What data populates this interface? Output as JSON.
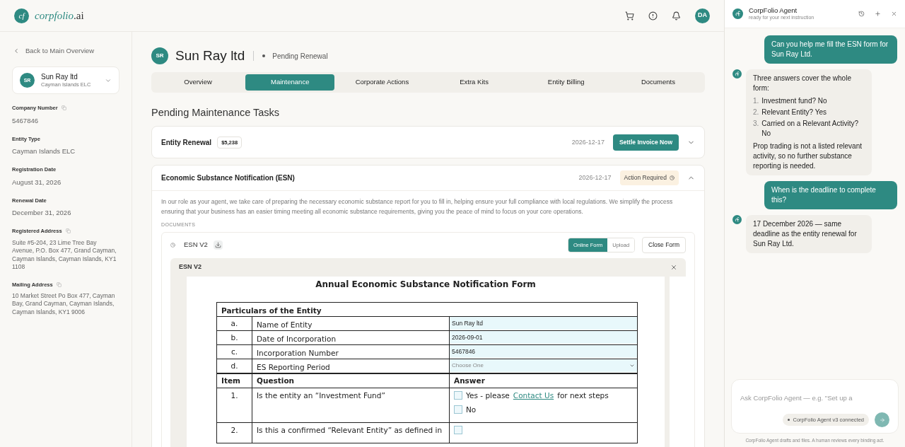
{
  "header": {
    "logo_mark": "cf",
    "logo_text": "corpfolio",
    "logo_suffix": ".ai",
    "avatar": "DA"
  },
  "sidebar": {
    "back_link": "Back to Main Overview",
    "entity": {
      "initials": "SR",
      "name": "Sun Ray ltd",
      "type": "Cayman Islands ELC"
    },
    "fields": [
      {
        "label": "Company Number",
        "copyable": true,
        "value": "5467846"
      },
      {
        "label": "Entity Type",
        "copyable": false,
        "value": "Cayman Islands ELC"
      },
      {
        "label": "Registration Date",
        "copyable": false,
        "value": "August 31, 2026"
      },
      {
        "label": "Renewal Date",
        "copyable": false,
        "value": "December 31, 2026"
      },
      {
        "label": "Registered Address",
        "copyable": true,
        "value": "Suite #5-204, 23 Lime Tree Bay Avenue, P.O. Box 477, Grand Cayman, Cayman Islands, Cayman Islands, KY1 1108"
      },
      {
        "label": "Mailing Address",
        "copyable": true,
        "value": "10 Market Street Po Box 477, Cayman Bay, Grand Cayman, Cayman Islands, Cayman Islands, KY1 9006"
      }
    ]
  },
  "entity_header": {
    "initials": "SR",
    "name": "Sun Ray ltd",
    "status": "Pending Renewal"
  },
  "tabs": [
    {
      "label": "Overview",
      "selected": false
    },
    {
      "label": "Maintenance",
      "selected": true
    },
    {
      "label": "Corporate Actions",
      "selected": false
    },
    {
      "label": "Extra Kits",
      "selected": false
    },
    {
      "label": "Entity Billing",
      "selected": false
    },
    {
      "label": "Documents",
      "selected": false
    }
  ],
  "section_title": "Pending Maintenance Tasks",
  "tasks": [
    {
      "title": "Entity Renewal",
      "amount": "$5,238",
      "date": "2026-12-17",
      "action": "Settle Invoice Now",
      "expanded": false
    },
    {
      "title": "Economic Substance Notification (ESN)",
      "date": "2026-12-17",
      "badge": "Action Required",
      "expanded": true,
      "description": "In our role as your agent, we take care of preparing the necessary economic substance report for you to fill in, helping ensure your full compliance with local regulations. We simplify the process ensuring that your business has an easier timing meeting all economic substance requirements, giving you the peace of mind to focus on your core operations.",
      "documents_label": "DOCUMENTS",
      "document": {
        "name": "ESN V2",
        "modes": [
          {
            "label": "Online Form",
            "selected": true
          },
          {
            "label": "Upload",
            "selected": false
          }
        ],
        "close": "Close Form",
        "viewer_title": "ESN V2",
        "form": {
          "title": "Annual Economic Substance Notification Form",
          "particulars_heading": "Particulars of the Entity",
          "particulars": [
            {
              "item": "a.",
              "label": "Name of Entity",
              "kind": "text",
              "value": "Sun Ray ltd"
            },
            {
              "item": "b.",
              "label": "Date of Incorporation",
              "kind": "text",
              "value": "2026-09-01"
            },
            {
              "item": "c.",
              "label": "Incorporation Number",
              "kind": "text",
              "value": "5467846"
            },
            {
              "item": "d.",
              "label": "ES Reporting Period",
              "kind": "select",
              "placeholder": "Choose One"
            }
          ],
          "columns": [
            "Item",
            "Question",
            "Answer"
          ],
          "questions": [
            {
              "item": "1.",
              "question": "Is the entity an “Investment Fund”",
              "options": [
                {
                  "before": "Yes - please",
                  "link": "Contact Us",
                  "after": "for next steps",
                  "checked": false
                },
                {
                  "before": "No",
                  "checked": false
                }
              ]
            },
            {
              "item": "2.",
              "question": "Is this a confirmed “Relevant Entity” as defined in",
              "options": [
                {
                  "checked": false
                }
              ]
            }
          ]
        }
      }
    }
  ],
  "agent": {
    "title": "CorpFolio Agent",
    "subtitle": "ready for your next instruction",
    "messages": [
      {
        "kind": "user",
        "text": "Can you help me fill the ESN form for Sun Ray Ltd."
      },
      {
        "kind": "agent",
        "text": "Three answers cover the whole form:",
        "list": [
          {
            "number": "1.",
            "text": "Investment fund? No"
          },
          {
            "number": "2.",
            "text": "Relevant Entity? Yes"
          },
          {
            "number": "3.",
            "text": "Carried on a Relevant Activity? No"
          }
        ],
        "footer": "Prop trading is not a listed relevant activity, so no further substance reporting is needed."
      },
      {
        "kind": "user",
        "text": "When is the deadline to complete this?"
      },
      {
        "kind": "agent",
        "text": "17 December 2026 — same deadline as the entity renewal for Sun Ray Ltd."
      }
    ],
    "input_placeholder": "Ask CorpFolio Agent — e.g. \"Set up a",
    "connection": "CorpFolio Agent v3 connected",
    "disclaimer": "CorpFolio Agent drafts and files. A human reviews every binding act."
  }
}
